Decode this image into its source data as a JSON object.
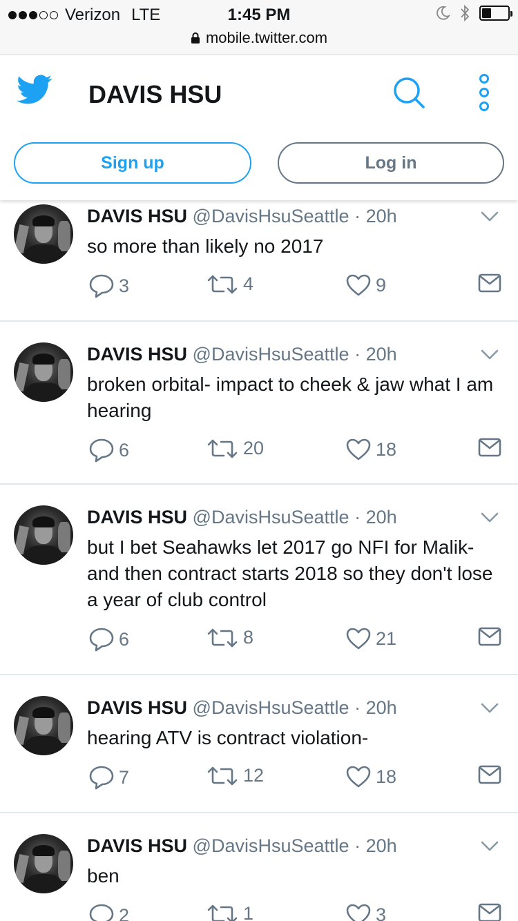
{
  "status_bar": {
    "carrier": "Verizon",
    "network": "LTE",
    "time": "1:45 PM",
    "url": "mobile.twitter.com",
    "signal_filled": 3,
    "signal_total": 5,
    "battery_level": 0.35
  },
  "header": {
    "title": "DAVIS HSU",
    "signup_label": "Sign up",
    "login_label": "Log in",
    "accent_color": "#1da1f2"
  },
  "tweets": [
    {
      "name": "DAVIS HSU",
      "handle": "@DavisHsuSeattle",
      "separator": "·",
      "time": "20h",
      "text": "so more than likely no 2017",
      "replies": "3",
      "retweets": "4",
      "likes": "9"
    },
    {
      "name": "DAVIS HSU",
      "handle": "@DavisHsuSeattle",
      "separator": "·",
      "time": "20h",
      "text": "broken orbital- impact to cheek & jaw what I am hearing",
      "replies": "6",
      "retweets": "20",
      "likes": "18"
    },
    {
      "name": "DAVIS HSU",
      "handle": "@DavisHsuSeattle",
      "separator": "·",
      "time": "20h",
      "text": "but I bet Seahawks let 2017 go NFI for Malik- and then contract starts 2018 so they don't lose a year of club control",
      "replies": "6",
      "retweets": "8",
      "likes": "21"
    },
    {
      "name": "DAVIS HSU",
      "handle": "@DavisHsuSeattle",
      "separator": "·",
      "time": "20h",
      "text": "hearing ATV is contract violation-",
      "replies": "7",
      "retweets": "12",
      "likes": "18"
    },
    {
      "name": "DAVIS HSU",
      "handle": "@DavisHsuSeattle",
      "separator": "·",
      "time": "20h",
      "text": "ben",
      "replies": "2",
      "retweets": "1",
      "likes": "3"
    }
  ]
}
